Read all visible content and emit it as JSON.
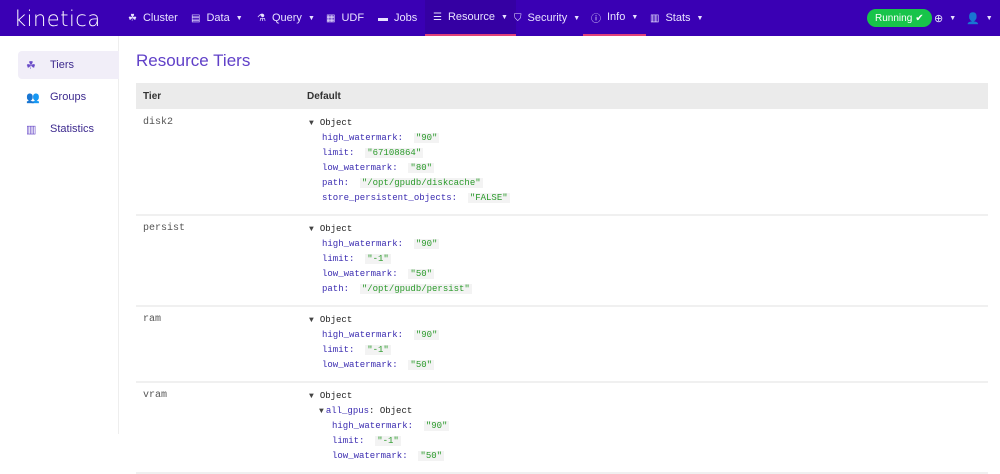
{
  "nav": {
    "logo": "kinetica",
    "items": [
      {
        "label": "Cluster",
        "icon": "cluster-icon",
        "glyph": "☘",
        "caret": false
      },
      {
        "label": "Data",
        "icon": "database-icon",
        "glyph": "▤",
        "caret": true
      },
      {
        "label": "Query",
        "icon": "flask-icon",
        "glyph": "⚗",
        "caret": true
      },
      {
        "label": "UDF",
        "icon": "grid-icon",
        "glyph": "▦",
        "caret": false
      },
      {
        "label": "Jobs",
        "icon": "jobs-icon",
        "glyph": "▬",
        "caret": false
      },
      {
        "label": "Resource",
        "icon": "sliders-icon",
        "glyph": "☰",
        "caret": true
      },
      {
        "label": "Security",
        "icon": "shield-icon",
        "glyph": "⛉",
        "caret": true
      },
      {
        "label": "Info",
        "icon": "info-icon",
        "glyph": "ⓘ",
        "caret": true
      },
      {
        "label": "Stats",
        "icon": "bar-chart-icon",
        "glyph": "▥",
        "caret": true
      }
    ],
    "status": "Running"
  },
  "sidebar": {
    "items": [
      {
        "label": "Tiers",
        "icon": "tiers-icon",
        "glyph": "☘"
      },
      {
        "label": "Groups",
        "icon": "groups-icon",
        "glyph": "👥"
      },
      {
        "label": "Statistics",
        "icon": "statistics-icon",
        "glyph": "▥"
      }
    ]
  },
  "main": {
    "title": "Resource Tiers",
    "columns": [
      "Tier",
      "Default"
    ],
    "rows": [
      {
        "tier": "disk2",
        "lines": [
          {
            "type": "obj",
            "text": "Object",
            "indent": 0
          },
          {
            "key": "high_watermark",
            "value": "\"90\"",
            "indent": 1
          },
          {
            "key": "limit",
            "value": "\"67108864\"",
            "indent": 1
          },
          {
            "key": "low_watermark",
            "value": "\"80\"",
            "indent": 1
          },
          {
            "key": "path",
            "value": "\"/opt/gpudb/diskcache\"",
            "indent": 1
          },
          {
            "key": "store_persistent_objects",
            "value": "\"FALSE\"",
            "indent": 1
          }
        ]
      },
      {
        "tier": "persist",
        "lines": [
          {
            "type": "obj",
            "text": "Object",
            "indent": 0
          },
          {
            "key": "high_watermark",
            "value": "\"90\"",
            "indent": 1
          },
          {
            "key": "limit",
            "value": "\"-1\"",
            "indent": 1
          },
          {
            "key": "low_watermark",
            "value": "\"50\"",
            "indent": 1
          },
          {
            "key": "path",
            "value": "\"/opt/gpudb/persist\"",
            "indent": 1
          }
        ]
      },
      {
        "tier": "ram",
        "lines": [
          {
            "type": "obj",
            "text": "Object",
            "indent": 0
          },
          {
            "key": "high_watermark",
            "value": "\"90\"",
            "indent": 1
          },
          {
            "key": "limit",
            "value": "\"-1\"",
            "indent": 1
          },
          {
            "key": "low_watermark",
            "value": "\"50\"",
            "indent": 1
          }
        ]
      },
      {
        "tier": "vram",
        "lines": [
          {
            "type": "obj",
            "text": "Object",
            "indent": 0
          },
          {
            "type": "subobj",
            "key": "all_gpus",
            "text": "Object",
            "indent": 1
          },
          {
            "key": "high_watermark",
            "value": "\"90\"",
            "indent": 2
          },
          {
            "key": "limit",
            "value": "\"-1\"",
            "indent": 2
          },
          {
            "key": "low_watermark",
            "value": "\"50\"",
            "indent": 2
          }
        ]
      }
    ]
  }
}
